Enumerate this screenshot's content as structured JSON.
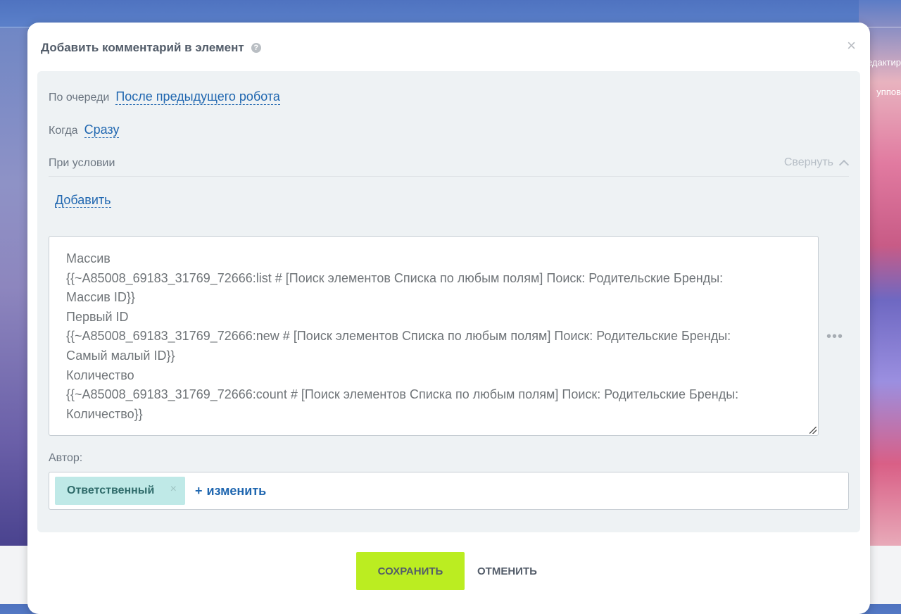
{
  "background": {
    "right_texts": [
      "едактир",
      "уппов"
    ]
  },
  "modal": {
    "title": "Добавить комментарий в элемент",
    "help_icon": "question-icon",
    "close_icon": "×",
    "order": {
      "label": "По очереди",
      "value": "После предыдущего робота"
    },
    "when": {
      "label": "Когда",
      "value": "Сразу"
    },
    "condition": {
      "label": "При условии",
      "collapse_label": "Свернуть"
    },
    "add_link": "Добавить",
    "comment_lines": [
      "Массив",
      "{{~A85008_69183_31769_72666:list # [Поиск элементов Списка по любым полям] Поиск: Родительские Бренды:",
      "Массив ID}}",
      "Первый ID",
      "{{~A85008_69183_31769_72666:new # [Поиск элементов Списка по любым полям] Поиск: Родительские Бренды:",
      "Самый малый ID}}",
      "Количество",
      "{{~A85008_69183_31769_72666:count # [Поиск элементов Списка по любым полям] Поиск: Родительские Бренды:",
      "Количество}}"
    ],
    "more_icon": "•••",
    "author": {
      "label": "Автор:",
      "tag": "Ответственный",
      "tag_remove": "×",
      "change_plus": "+",
      "change_label": "изменить"
    },
    "buttons": {
      "save": "СОХРАНИТЬ",
      "cancel": "ОТМЕНИТЬ"
    }
  },
  "colors": {
    "accent_link": "#2067b0",
    "save_button": "#bbed21",
    "tag_bg": "#bfe9e7"
  }
}
